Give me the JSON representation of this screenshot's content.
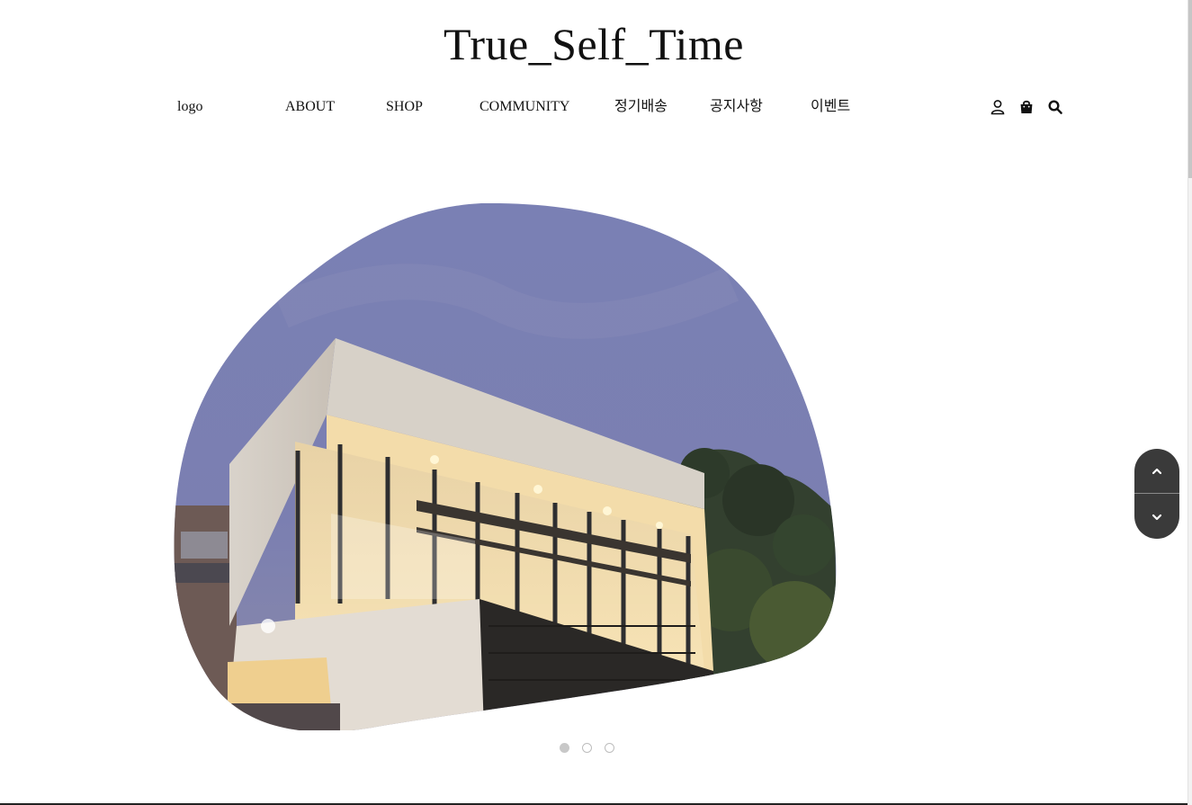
{
  "site": {
    "title": "True_Self_Time"
  },
  "nav": {
    "logo": "logo",
    "items": [
      "ABOUT",
      "SHOP",
      "COMMUNITY",
      "정기배송",
      "공지사항",
      "이벤트"
    ],
    "icons": [
      "user-icon",
      "shopping-bag-icon",
      "search-icon"
    ]
  },
  "hero": {
    "image": "modern-glass-building-at-dusk",
    "slides_total": 3,
    "active_slide": 1
  },
  "colors": {
    "text": "#111111",
    "scroll_control_bg": "#3a3a3a",
    "sky": "#7e82b2",
    "warm_light": "#f2d79a"
  }
}
